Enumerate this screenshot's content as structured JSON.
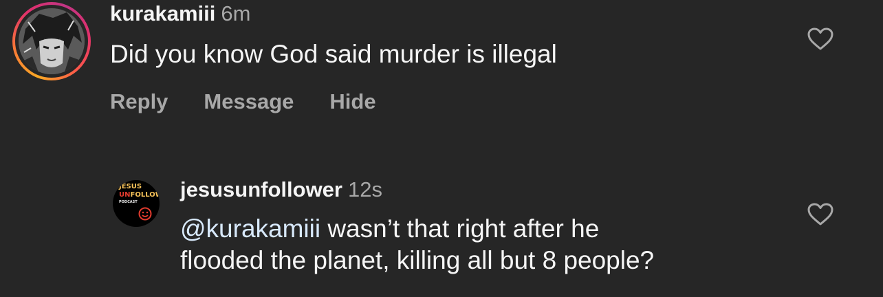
{
  "comments": [
    {
      "username": "kurakamiii",
      "time": "6m",
      "text": "Did you know God said murder is illegal",
      "actions": {
        "reply": "Reply",
        "message": "Message",
        "hide": "Hide"
      },
      "avatar_icon": "anime-character-avatar",
      "story_ring": true
    },
    {
      "username": "jesusunfollower",
      "time": "12s",
      "mention": "@kurakamiii",
      "text_line1_rest": " wasn’t that right after he",
      "text_line2": "flooded the planet, killing all but 8 people?",
      "avatar_logo": {
        "line1": "JESUS",
        "line2_prefix": "UN",
        "line2_rest": "FOLLOWER",
        "line3": "PODCAST"
      }
    }
  ],
  "icons": {
    "like": "heart-outline-icon"
  },
  "colors": {
    "background": "#262626",
    "primary_text": "#f5f5f5",
    "secondary_text": "#a8a8a8",
    "logo_yellow": "#f7c35a",
    "logo_red": "#e23b2e"
  }
}
